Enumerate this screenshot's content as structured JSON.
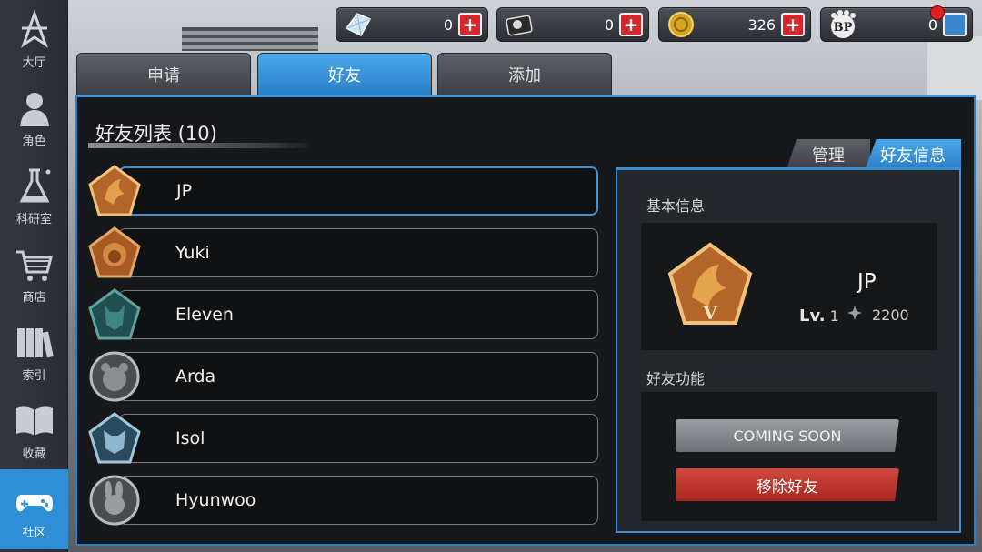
{
  "sidebar": {
    "items": [
      {
        "label": "大厅",
        "icon": "lobby-star-icon"
      },
      {
        "label": "角色",
        "icon": "character-icon"
      },
      {
        "label": "科研室",
        "icon": "flask-icon"
      },
      {
        "label": "商店",
        "icon": "cart-icon"
      },
      {
        "label": "索引",
        "icon": "books-icon"
      },
      {
        "label": "收藏",
        "icon": "open-book-icon"
      },
      {
        "label": "社区",
        "icon": "gamepad-icon",
        "active": true
      }
    ]
  },
  "resources": [
    {
      "icon": "crystal-icon",
      "value": "0"
    },
    {
      "icon": "disc-icon",
      "value": "0"
    },
    {
      "icon": "coin-icon",
      "value": "326"
    },
    {
      "icon": "bp-paw-icon",
      "value": "0",
      "bp_text": "BP"
    }
  ],
  "tabs": [
    {
      "label": "申请"
    },
    {
      "label": "好友",
      "active": true
    },
    {
      "label": "添加"
    }
  ],
  "friend_list": {
    "title": "好友列表 (10)",
    "friends": [
      {
        "name": "JP",
        "badge": "dragon-badge-icon",
        "selected": true
      },
      {
        "name": "Yuki",
        "badge": "lion-badge-icon"
      },
      {
        "name": "Eleven",
        "badge": "wolf-badge-icon"
      },
      {
        "name": "Arda",
        "badge": "bear-badge-icon"
      },
      {
        "name": "Isol",
        "badge": "beast-badge-icon"
      },
      {
        "name": "Hyunwoo",
        "badge": "rabbit-badge-icon"
      }
    ]
  },
  "info_panel": {
    "tabs": {
      "manage": "管理",
      "friend_info": "好友信息"
    },
    "basic_info_label": "基本信息",
    "player": {
      "name": "JP",
      "lv_label": "Lv.",
      "level": "1",
      "score": "2200",
      "rank_numeral": "V"
    },
    "functions_label": "好友功能",
    "coming_soon": "COMING SOON",
    "remove_friend": "移除好友"
  },
  "colors": {
    "accent": "#2f8fd6",
    "remove": "#b8322b",
    "plus": "#d8262c"
  }
}
